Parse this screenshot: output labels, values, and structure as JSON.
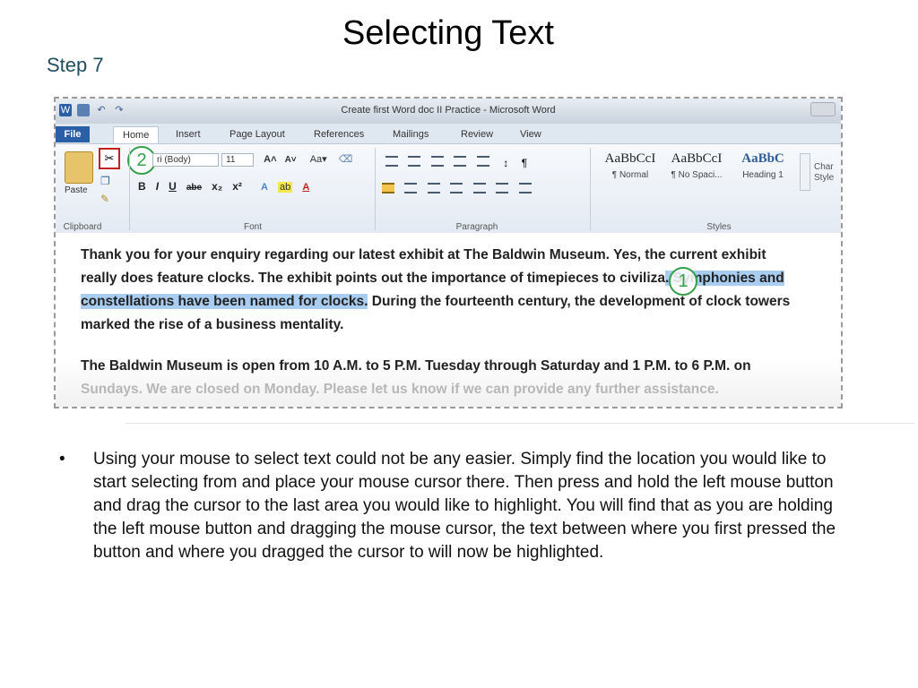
{
  "slide": {
    "title": "Selecting Text",
    "step": "Step 7"
  },
  "word_window": {
    "title": "Create first Word doc II Practice - Microsoft Word",
    "tabs": [
      "File",
      "Home",
      "Insert",
      "Page Layout",
      "References",
      "Mailings",
      "Review",
      "View"
    ],
    "active_tab": "Home",
    "groups": {
      "clipboard": "Clipboard",
      "font": "Font",
      "paragraph": "Paragraph",
      "styles": "Styles"
    },
    "paste_label": "Paste",
    "font_name": "ri (Body)",
    "font_size": "11",
    "font_buttons": [
      "B",
      "I",
      "U",
      "abe",
      "x₂",
      "x²"
    ],
    "styles": [
      {
        "sample": "AaBbCcI",
        "name": "¶ Normal"
      },
      {
        "sample": "AaBbCcI",
        "name": "¶ No Spaci..."
      },
      {
        "sample": "AaBbC",
        "name": "Heading 1"
      }
    ],
    "change_styles": "Char Style",
    "callouts": {
      "cut": "2",
      "selection": "1"
    },
    "accent_colors": {
      "file_tab": "#2a5fa6",
      "highlight": "#a9cdf0",
      "callout": "#35a04b",
      "cut_box": "#c32020"
    }
  },
  "document": {
    "para1_start": "Thank you for your enquiry regarding our latest exhibit at The Baldwin Museum. Yes, the current exhibit really does feature clocks. The exhibit points out the importance of timepieces to civiliza",
    "para1_highlight": ". Symphonies and constellations have been named for clocks.",
    "para1_end": " During the fourteenth century, the development of clock towers marked the rise of a business mentality.",
    "para2": "The Baldwin Museum is open from 10 A.M. to 5 P.M. Tuesday through Saturday and 1 P.M. to 6 P.M. on",
    "para2_faded": "Sundays. We are closed on Monday. Please let us know if we can provide any further assistance."
  },
  "bullets": [
    "Using your mouse to select text could not be any easier. Simply find the location you would like to start selecting from and place your mouse cursor there. Then press and hold the left mouse button and drag the cursor to the last area you would like to highlight. You will find that as you are holding the left mouse button and dragging the mouse cursor, the text between where you first pressed the button and where you dragged the cursor to will now be highlighted."
  ],
  "bullet_symbol": "•"
}
